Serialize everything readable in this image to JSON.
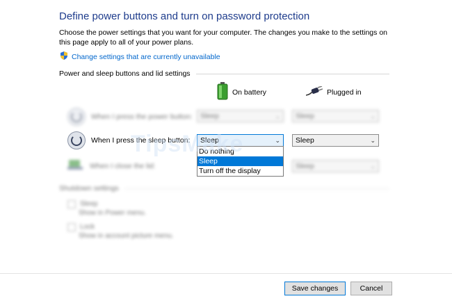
{
  "title": "Define power buttons and turn on password protection",
  "description": "Choose the power settings that you want for your computer. The changes you make to the settings on this page apply to all of your power plans.",
  "change_settings_link": "Change settings that are currently unavailable",
  "section_power": "Power and sleep buttons and lid settings",
  "columns": {
    "battery": "On battery",
    "plugged": "Plugged in"
  },
  "rows": [
    {
      "label": "When I press the power button:",
      "battery": "Sleep",
      "plugged": "Sleep"
    },
    {
      "label": "When I press the sleep button:",
      "battery": "Sleep",
      "plugged": "Sleep"
    },
    {
      "label": "When I close the lid:",
      "battery": "Sleep",
      "plugged": "Sleep"
    }
  ],
  "dropdown_options": [
    "Do nothing",
    "Sleep",
    "Turn off the display"
  ],
  "dropdown_selected": "Sleep",
  "section_shutdown": "Shutdown settings",
  "shutdown_items": [
    {
      "label": "Sleep",
      "desc": "Show in Power menu."
    },
    {
      "label": "Lock",
      "desc": "Show in account picture menu."
    }
  ],
  "buttons": {
    "save": "Save changes",
    "cancel": "Cancel"
  },
  "watermark": "TipsMake",
  "colors": {
    "title": "#1e3c8c",
    "link": "#0066cc",
    "selection": "#0078d7"
  }
}
